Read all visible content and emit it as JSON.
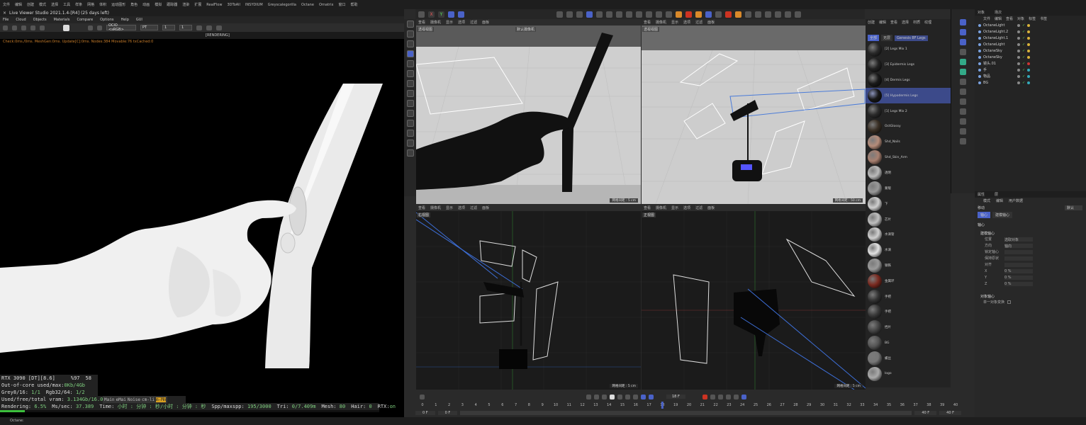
{
  "top_menu": [
    "文件",
    "编辑",
    "创建",
    "模式",
    "选择",
    "工具",
    "样条",
    "网格",
    "体积",
    "运动图形",
    "角色",
    "动画",
    "模拟",
    "跟踪器",
    "渲染",
    "扩展",
    "RealFlow",
    "3DToAll",
    "INSYDIUM",
    "Greyscalegorilla",
    "Octane",
    "Ornatrix",
    "窗口",
    "帮助"
  ],
  "live_viewer": {
    "title": "Live Viewer Studio 2021.1.4-[R4] (25 days left)",
    "menu": [
      "File",
      "Cloud",
      "Objects",
      "Materials",
      "Compare",
      "Options",
      "Help",
      "GUI"
    ],
    "ocio_value": "OCIO <sRGB>",
    "pt_value": "PT",
    "spin1": "1",
    "spin2": "1",
    "rendering_tag": "[RENDERING]",
    "status_line": "Check:0ms./0ms. MeshGen:0ms. Update[C]:0ms. Nodes:384 Movable:76 txCached:0",
    "stats": {
      "gpu": "RTX 3090 [DT][8.6]",
      "gpu_pct": "%97",
      "gpu_temp": "58",
      "ooc_label": "Out-of-core used/max:",
      "ooc_value": "0Kb/4Gb",
      "grey_label": "Grey8/16:",
      "grey_value": "1/1",
      "rgb_label": "Rgb32/64:",
      "rgb_value": "1/2",
      "vram_label": "Used/free/total vram:",
      "vram_value": "3.134Gb/16.043Gb/2",
      "passes": [
        "Main",
        "eMai",
        "Noise",
        "cm-li",
        "m-Mn"
      ],
      "rendering_label": "Rendering:",
      "rendering_value": "6.5%",
      "mssec_label": "Ms/sec:",
      "mssec_value": "37.389",
      "time_label": "Time:",
      "time_value": "小时 : 分钟 : 秒/小时 : 分钟 : 秒",
      "spp_label": "Spp/maxspp:",
      "spp_value": "195/3000",
      "tri_label": "Tri:",
      "tri_value": "0/7.409m",
      "mesh_label": "Mesh:",
      "mesh_value": "80",
      "hair_label": "Hair:",
      "hair_value": "0",
      "rtx_label": "RTX:",
      "rtx_value": "on",
      "progress": 0.065
    }
  },
  "viewports": {
    "menu": [
      "查看",
      "摄像机",
      "显示",
      "选项",
      "过滤",
      "面板"
    ],
    "tl_label": "透视视图",
    "tl_cam": "默认摄像机",
    "tr_label": "透视视图",
    "bl_label": "右视图",
    "br_label": "正视图",
    "tl_foot": "网格间距 : 5 cm",
    "tr_foot": "网格间距 : 50 cm",
    "bl_foot": "网格间距 : 5 cm",
    "br_foot": "网格间距 : 5 cm"
  },
  "material_panel": {
    "menu": [
      "创建",
      "编辑",
      "查看",
      "选择",
      "材质",
      "纹理"
    ],
    "tabs": [
      "全部",
      "无层",
      "Genesis 8F Legs"
    ],
    "materials": [
      {
        "name": "[2] Legs Mix 1",
        "color": "#2a2a2a"
      },
      {
        "name": "[3] Epidermis Legs",
        "color": "#222"
      },
      {
        "name": "[4] Dermis Legs",
        "color": "#1a1a1a"
      },
      {
        "name": "[5] Hypodermis Legs",
        "color": "#181818"
      },
      {
        "name": "[1] Legs Mix 2",
        "color": "#2b2b2b"
      },
      {
        "name": "OctGlossy",
        "color": "#3a3025"
      },
      {
        "name": "Shd_Nails",
        "color": "#b58c7a"
      },
      {
        "name": "Shd_Skin_Arm",
        "color": "#a88070"
      },
      {
        "name": "透明",
        "color": "#bbbbbb"
      },
      {
        "name": "蒙版",
        "color": "#999999"
      },
      {
        "name": "下",
        "color": "#cfcfcf"
      },
      {
        "name": "芯片",
        "color": "#bfbfbf"
      },
      {
        "name": "水滴管",
        "color": "#d0d0d0"
      },
      {
        "name": "水滴",
        "color": "#e2e2e2"
      },
      {
        "name": "钢铁",
        "color": "#9a9a9a"
      },
      {
        "name": "金属环",
        "color": "#7a2a20"
      },
      {
        "name": "手把",
        "color": "#333"
      },
      {
        "name": "手把",
        "color": "#3a3a3a"
      },
      {
        "name": "挡片",
        "color": "#444"
      },
      {
        "name": "BG",
        "color": "#555"
      },
      {
        "name": "螺丝",
        "color": "#777"
      },
      {
        "name": "logo",
        "color": "#aaa"
      }
    ]
  },
  "object_panel": {
    "tabs": [
      "对象",
      "场次"
    ],
    "menu": [
      "文件",
      "编辑",
      "查看",
      "对象",
      "标签",
      "书签"
    ],
    "objects": [
      "OctaneLight",
      "OctaneLight.2",
      "OctaneLight.1",
      "OctaneLight",
      "OctaneSky",
      "OctaneSky",
      "镜头.01",
      "手",
      "物品",
      "BG"
    ]
  },
  "attributes": {
    "tabs": [
      "属性",
      "层"
    ],
    "menu": [
      "模式",
      "编辑",
      "用户数据"
    ],
    "mode_label": "移动",
    "preset": "默认",
    "tabs2": [
      "轴心",
      "建模轴心"
    ],
    "section1": "轴心",
    "section2": "建模轴心",
    "rows": [
      {
        "label": "位置",
        "value": "选取对象"
      },
      {
        "label": "方向",
        "value": "轴向"
      },
      {
        "label": "锁定轴心",
        "value": ""
      },
      {
        "label": "保持原状",
        "value": ""
      },
      {
        "label": "对齐",
        "value": ""
      },
      {
        "label": "X",
        "value": "0 %"
      },
      {
        "label": "Y",
        "value": "0 %"
      },
      {
        "label": "Z",
        "value": "0 %"
      }
    ],
    "section3": "对象轴心",
    "row_last": "单一对象变换"
  },
  "timeline": {
    "frame": "18 F",
    "start": "0 F",
    "start2": "0 F",
    "end": "40 F",
    "end2": "40 F",
    "ticks": [
      "0",
      "1",
      "2",
      "3",
      "4",
      "5",
      "6",
      "7",
      "8",
      "9",
      "10",
      "11",
      "12",
      "13",
      "14",
      "15",
      "16",
      "17",
      "18",
      "19",
      "20",
      "21",
      "22",
      "23",
      "24",
      "25",
      "26",
      "27",
      "28",
      "29",
      "30",
      "31",
      "32",
      "33",
      "34",
      "35",
      "36",
      "37",
      "38",
      "39",
      "40"
    ],
    "current_frame": 18
  },
  "statusbar": "Octane:"
}
